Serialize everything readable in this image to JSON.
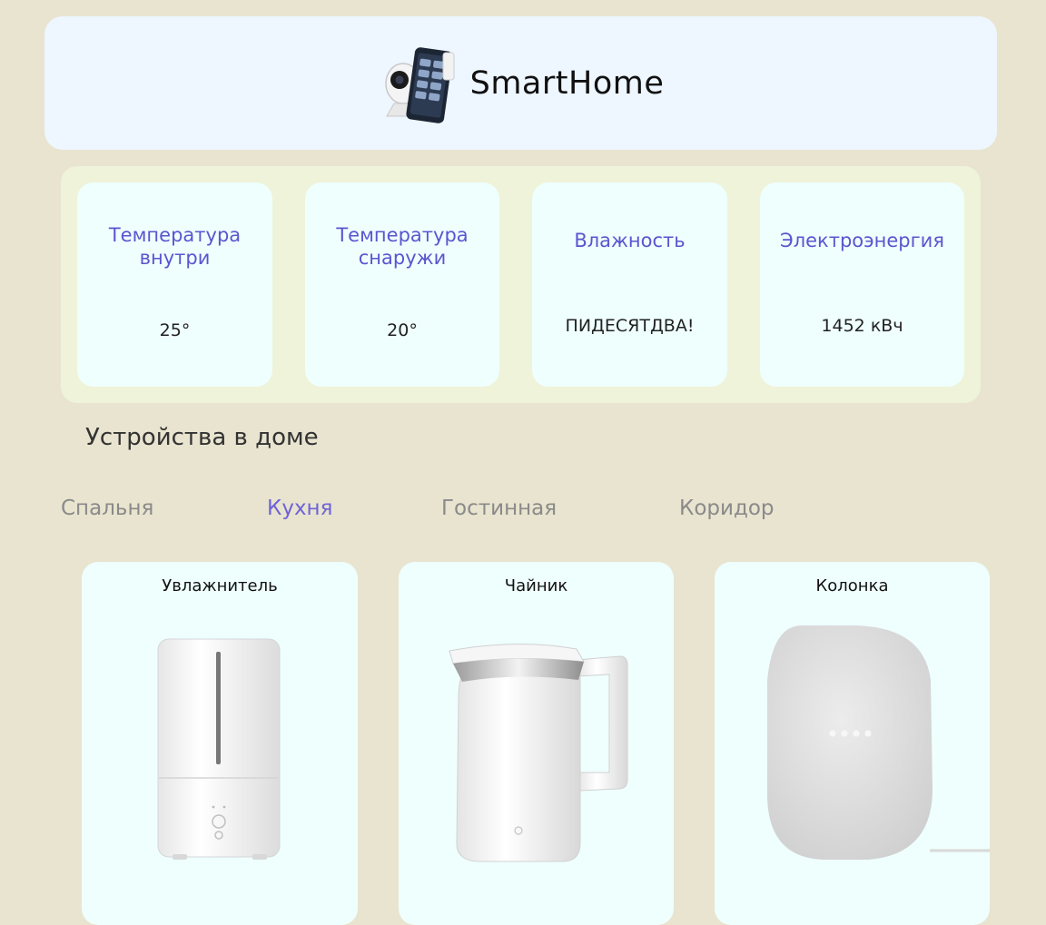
{
  "header": {
    "logo_icon": "smart-devices-logo",
    "title": "SmartHome"
  },
  "stats": [
    {
      "label": "Температура внутри",
      "value": "25°"
    },
    {
      "label": "Температура снаружи",
      "value": "20°"
    },
    {
      "label": "Влажность",
      "value": "ПИДЕСЯТДВА!"
    },
    {
      "label": "Электроэнергия",
      "value": "1452 кВч"
    }
  ],
  "devices_section": {
    "title": "Устройства в доме",
    "tabs": [
      "Спальня",
      "Кухня",
      "Гостинная",
      "Коридор"
    ],
    "active_tab": "Кухня"
  },
  "devices": [
    {
      "name": "Увлажнитель",
      "icon": "humidifier"
    },
    {
      "name": "Чайник",
      "icon": "kettle"
    },
    {
      "name": "Колонка",
      "icon": "smart-speaker"
    }
  ],
  "colors": {
    "page_bg": "#e8e4cf",
    "header_bg": "#eef6ff",
    "stats_panel_bg": "#eff3d9",
    "card_bg": "#effffe",
    "accent": "#5b55cf",
    "tab_inactive": "#8a8a8a"
  }
}
